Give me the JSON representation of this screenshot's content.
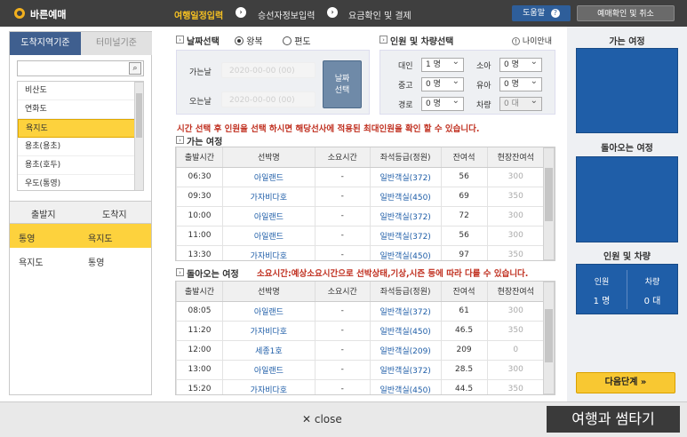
{
  "header": {
    "brand": "바른예매",
    "steps": [
      "여행일정입력",
      "승선자정보입력",
      "요금확인 및 결제"
    ],
    "step_sep_icon": "chevron-right-circle-icon",
    "help_label": "도움말",
    "help_icon": "question-circle-icon",
    "confirm_label": "예매확인 및 취소",
    "accent": "#f5c022"
  },
  "left": {
    "tab_active": "도착지역기준",
    "tab_inactive": "터미널기준",
    "search_value": "",
    "search_icon": "magnifier-icon",
    "regions": [
      "비산도",
      "연화도",
      "욕지도",
      "용초(용초)",
      "용초(호두)",
      "우도(통영)"
    ],
    "selected_region_index": 2,
    "route_headers": [
      "출발지",
      "도착지"
    ],
    "routes": [
      {
        "from": "통영",
        "to": "욕지도",
        "selected": true
      },
      {
        "from": "욕지도",
        "to": "통영",
        "selected": false
      }
    ]
  },
  "date": {
    "section_title": "날짜선택",
    "trip_options": [
      "왕복",
      "편도"
    ],
    "trip_selected": "왕복",
    "go_label": "가는날",
    "return_label": "오는날",
    "go_value": "2020-00-00 (00)",
    "return_value": "2020-00-00 (00)",
    "date_button": "날짜\n선택"
  },
  "passengers": {
    "section_title": "인원 및 차량선택",
    "age_guide": "나이안내",
    "age_guide_icon": "exclamation-circle-icon",
    "fields": [
      {
        "label": "대인",
        "value": "1 명"
      },
      {
        "label": "소아",
        "value": "0 명"
      },
      {
        "label": "중고",
        "value": "0 명"
      },
      {
        "label": "유아",
        "value": "0 명"
      },
      {
        "label": "경로",
        "value": "0 명"
      },
      {
        "label": "차량",
        "value": "0 대"
      }
    ]
  },
  "notice": "시간 선택 후 인원을 선택 하시면 해당선사에 적용된 최대인원을 확인 할 수 있습니다.",
  "outbound": {
    "title": "가는 여정",
    "headers": [
      "출발시간",
      "선박명",
      "소요시간",
      "좌석등급(정원)",
      "잔여석",
      "현장잔여석"
    ],
    "rows": [
      [
        "06:30",
        "아일랜드",
        "-",
        "일반객실(372)",
        "56",
        "300"
      ],
      [
        "09:30",
        "가자비다호",
        "-",
        "일반객실(450)",
        "69",
        "350"
      ],
      [
        "10:00",
        "아일랜드",
        "-",
        "일반객실(372)",
        "72",
        "300"
      ],
      [
        "11:00",
        "아일랜드",
        "-",
        "일반객실(372)",
        "56",
        "300"
      ],
      [
        "13:30",
        "가자비다호",
        "-",
        "일반객실(450)",
        "97",
        "350"
      ]
    ]
  },
  "inbound": {
    "title": "돌아오는 여정",
    "note": "소요시간:예상소요시간으로 선박상태,기상,시즌 등에 따라 다를 수 있습니다.",
    "headers": [
      "출발시간",
      "선박명",
      "소요시간",
      "좌석등급(정원)",
      "잔여석",
      "현장잔여석"
    ],
    "rows": [
      [
        "08:05",
        "아일랜드",
        "-",
        "일반객실(372)",
        "61",
        "300"
      ],
      [
        "11:20",
        "가자비다호",
        "-",
        "일반객실(450)",
        "46.5",
        "350"
      ],
      [
        "12:00",
        "세종1호",
        "-",
        "일반객실(209)",
        "209",
        "0"
      ],
      [
        "13:00",
        "아일랜드",
        "-",
        "일반객실(372)",
        "28.5",
        "300"
      ],
      [
        "15:20",
        "가자비다호",
        "-",
        "일반객실(450)",
        "44.5",
        "350"
      ]
    ]
  },
  "summary": {
    "go_title": "가는 여정",
    "return_title": "돌아오는 여정",
    "pax_title": "인원 및 차량",
    "pax_label": "인원",
    "car_label": "차량",
    "pax_value": "1 명",
    "car_value": "0 대",
    "next_label": "다음단계 »"
  },
  "footer": {
    "close_label": "✕ close",
    "caption": "여행과 썸타기"
  }
}
